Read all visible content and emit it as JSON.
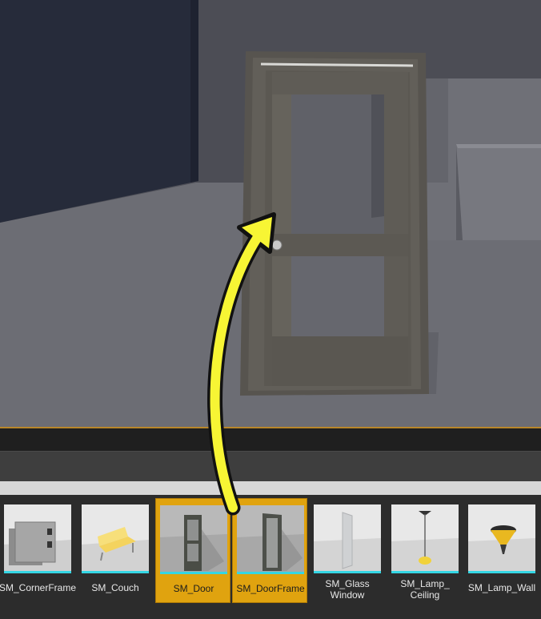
{
  "viewport": {
    "objects": [
      {
        "name": "SM_Door",
        "type": "door-with-frame",
        "knob": "round-silver"
      },
      {
        "name": "box",
        "type": "cube"
      }
    ],
    "colors": {
      "floor": "#6e6f76",
      "left_wall": "#262b3a",
      "back_wall": "#4c4d55",
      "door": "#5e5b56",
      "annotation_arrow": "#f7f534"
    }
  },
  "content_browser": {
    "assets": [
      {
        "label": "SM_CornerFrame",
        "selected": false,
        "icon": "corner-frame-icon"
      },
      {
        "label": "SM_Couch",
        "selected": false,
        "icon": "couch-icon"
      },
      {
        "label": "SM_Door",
        "selected": true,
        "icon": "door-icon"
      },
      {
        "label": "SM_DoorFrame",
        "selected": true,
        "icon": "door-frame-icon"
      },
      {
        "label": "SM_Glass\nWindow",
        "selected": false,
        "icon": "glass-window-icon"
      },
      {
        "label": "SM_Lamp_\nCeiling",
        "selected": false,
        "icon": "ceiling-lamp-icon"
      },
      {
        "label": "SM_Lamp_Wall",
        "selected": false,
        "icon": "wall-lamp-icon"
      }
    ],
    "colors": {
      "selected": "#e0a30f",
      "underline": "#35d6e4"
    }
  }
}
